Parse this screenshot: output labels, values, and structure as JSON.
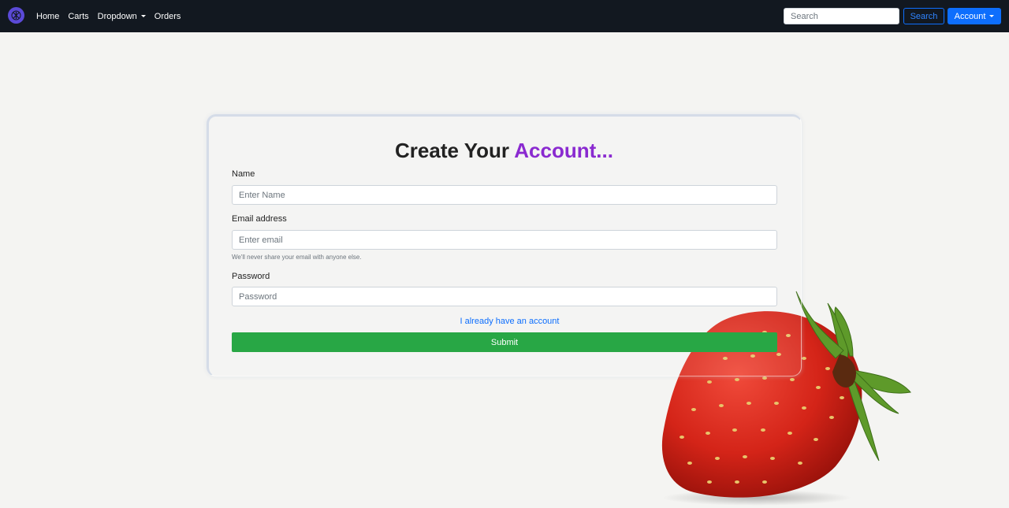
{
  "nav": {
    "links": [
      "Home",
      "Carts",
      "Dropdown",
      "Orders"
    ],
    "search_placeholder": "Search",
    "search_button": "Search",
    "account_button": "Account"
  },
  "form": {
    "title_main": "Create Your ",
    "title_accent": "Account...",
    "name_label": "Name",
    "name_placeholder": "Enter Name",
    "email_label": "Email address",
    "email_placeholder": "Enter email",
    "email_help": "We'll never share your email with anyone else.",
    "password_label": "Password",
    "password_placeholder": "Password",
    "login_link": "I already have an account",
    "submit_label": "Submit"
  },
  "colors": {
    "navbar_bg": "#121820",
    "accent_purple": "#8a2ad0",
    "primary_blue": "#0d6efd",
    "submit_green": "#28a745"
  }
}
